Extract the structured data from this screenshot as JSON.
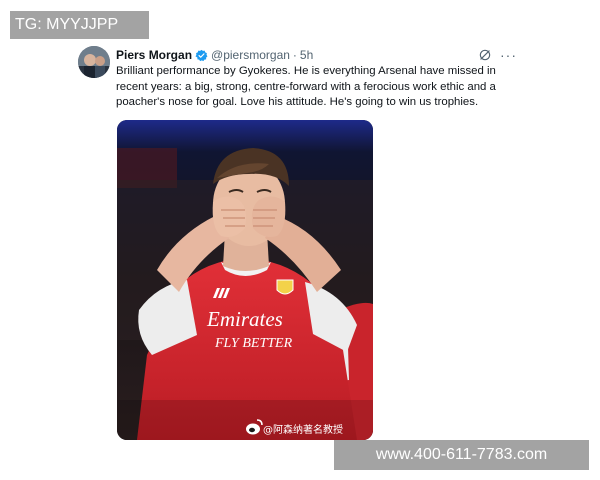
{
  "overlays": {
    "top_left_tag": "TG: MYYJJPP",
    "bottom_right_url": "www.400-611-7783.com"
  },
  "tweet": {
    "author_name": "Piers Morgan",
    "handle": "@piersmorgan",
    "separator": "·",
    "time": "5h",
    "text": "Brilliant performance by Gyokeres. He is everything Arsenal have missed in recent years: a big, strong, centre-forward with a ferocious work ethic and a poacher's nose for goal. Love his attitude. He's going to win us trophies.",
    "more_label": "···",
    "media": {
      "sponsor_line1": "Emirates",
      "sponsor_line2": "FLY BETTER",
      "image_watermark": "@阿森纳著名教授"
    }
  },
  "colors": {
    "verified": "#1d9bf0",
    "secondary_text": "#536471",
    "kit_red": "#d8262e"
  },
  "icons": [
    "verified-badge-icon",
    "grok-icon",
    "more-icon",
    "weibo-icon"
  ]
}
